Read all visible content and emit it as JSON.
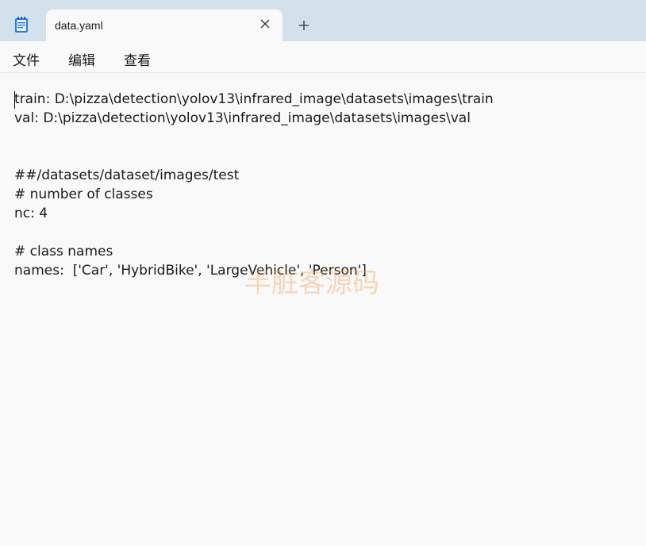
{
  "window": {
    "tab_title": "data.yaml",
    "icons": {
      "app": "notepad-icon",
      "close": "close-icon",
      "new_tab": "plus-icon"
    }
  },
  "menu": {
    "file": "文件",
    "edit": "编辑",
    "view": "查看"
  },
  "editor": {
    "lines": [
      "train: D:\\pizza\\detection\\yolov13\\infrared_image\\datasets\\images\\train",
      "val: D:\\pizza\\detection\\yolov13\\infrared_image\\datasets\\images\\val",
      "",
      "",
      "##/datasets/dataset/images/test",
      "# number of classes",
      "nc: 4",
      "",
      "# class names",
      "names:  ['Car', 'HybridBike', 'LargeVehicle', 'Person']"
    ]
  },
  "watermark": "半脏客源码"
}
